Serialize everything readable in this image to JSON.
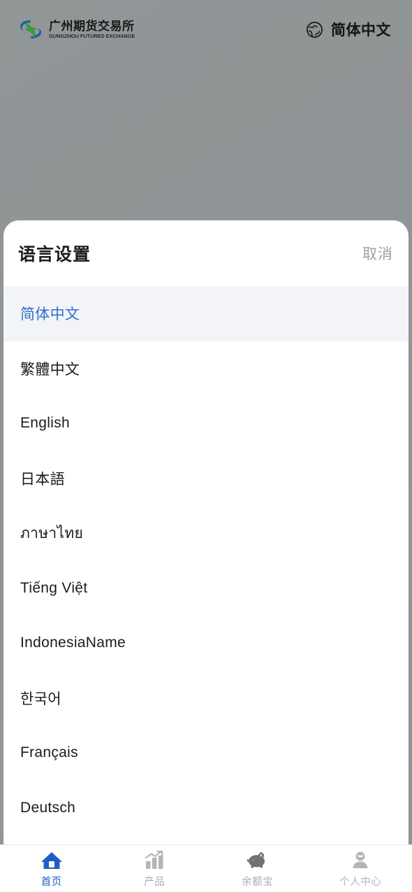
{
  "app_header": {
    "brand": {
      "cn_name": "广州期货交易所",
      "en_name": "GUNGZHOU FUTURES EXCHANGE",
      "logo_icon": "swirl-logo-icon"
    },
    "language_switch": {
      "icon": "globe-icon",
      "label": "简体中文"
    }
  },
  "sheet": {
    "title": "语言设置",
    "cancel_label": "取消",
    "languages": [
      {
        "label": "简体中文",
        "selected": true
      },
      {
        "label": "繁體中文",
        "selected": false
      },
      {
        "label": "English",
        "selected": false
      },
      {
        "label": "日本語",
        "selected": false
      },
      {
        "label": "ภาษาไทย",
        "selected": false
      },
      {
        "label": "Tiếng Việt",
        "selected": false
      },
      {
        "label": "IndonesiaName",
        "selected": false
      },
      {
        "label": "한국어",
        "selected": false
      },
      {
        "label": "Français",
        "selected": false
      },
      {
        "label": "Deutsch",
        "selected": false
      }
    ]
  },
  "tabbar": {
    "items": [
      {
        "label": "首页",
        "icon": "home-icon",
        "active": true
      },
      {
        "label": "产品",
        "icon": "bar-chart-trend-icon",
        "active": false
      },
      {
        "label": "余额宝",
        "icon": "piggy-bank-icon",
        "active": false
      },
      {
        "label": "个人中心",
        "icon": "person-icon",
        "active": false
      }
    ]
  },
  "colors": {
    "accent_blue": "#1e5fc4",
    "selected_row_bg": "#f2f4f7",
    "selected_row_text": "#2f6fd0",
    "backdrop_gray": "#919597",
    "muted_text": "#b2b6bb",
    "logo_blue": "#1c5aa8",
    "logo_green": "#3a9a42"
  }
}
